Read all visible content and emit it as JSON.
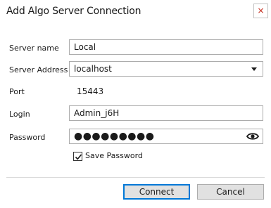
{
  "window": {
    "title": "Add Algo Server Connection",
    "close_glyph": "×"
  },
  "form": {
    "server_name": {
      "label": "Server name",
      "value": "Local"
    },
    "server_address": {
      "label": "Server Address",
      "value": "localhost"
    },
    "port": {
      "label": "Port",
      "value": "15443"
    },
    "login": {
      "label": "Login",
      "value": "Admin_j6H"
    },
    "password": {
      "label": "Password",
      "masked_value": "●●●●●●●●●",
      "reveal_icon": "eye-icon"
    },
    "save_password": {
      "label": "Save Password",
      "checked": true
    }
  },
  "buttons": {
    "connect": "Connect",
    "cancel": "Cancel"
  },
  "colors": {
    "close_x": "#c42b1c",
    "primary_border": "#0078d7"
  }
}
